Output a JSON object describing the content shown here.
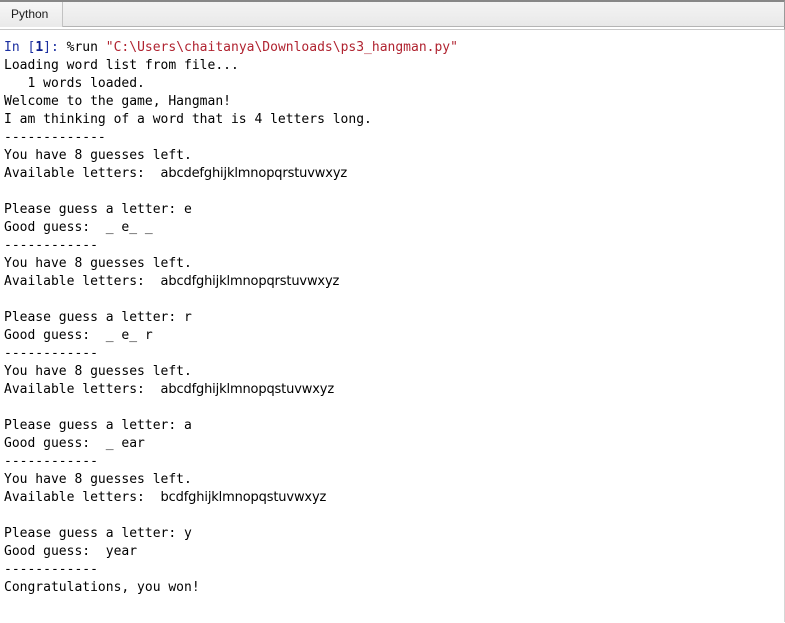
{
  "window": {
    "tab_label": "Python"
  },
  "console": {
    "prompt": {
      "prefix": "In [",
      "number": "1",
      "suffix": "]: ",
      "command": "%run ",
      "path": "\"C:\\Users\\chaitanya\\Downloads\\ps3_hangman.py\""
    },
    "lines": [
      {
        "id": "loading",
        "text": "Loading word list from file..."
      },
      {
        "id": "words-loaded",
        "text": "   1 words loaded."
      },
      {
        "id": "welcome",
        "text": "Welcome to the game, Hangman!"
      },
      {
        "id": "word-length",
        "text": "I am thinking of a word that is 4 letters long."
      },
      {
        "id": "sep-1",
        "text": "-------------"
      },
      {
        "id": "guesses-1",
        "text": "You have 8 guesses left."
      },
      {
        "id": "available-1",
        "label": "Available letters:  ",
        "letters": "abcdefghijklmnopqrstuvwxyz"
      },
      {
        "id": "blank-1",
        "text": ""
      },
      {
        "id": "guess-prompt-1",
        "text": "Please guess a letter: e"
      },
      {
        "id": "good-guess-1",
        "text": "Good guess:  _ e_ _"
      },
      {
        "id": "sep-2",
        "text": "------------"
      },
      {
        "id": "guesses-2",
        "text": "You have 8 guesses left."
      },
      {
        "id": "available-2",
        "label": "Available letters:  ",
        "letters": "abcdfghijklmnopqrstuvwxyz"
      },
      {
        "id": "blank-2",
        "text": ""
      },
      {
        "id": "guess-prompt-2",
        "text": "Please guess a letter: r"
      },
      {
        "id": "good-guess-2",
        "text": "Good guess:  _ e_ r"
      },
      {
        "id": "sep-3",
        "text": "------------"
      },
      {
        "id": "guesses-3",
        "text": "You have 8 guesses left."
      },
      {
        "id": "available-3",
        "label": "Available letters:  ",
        "letters": "abcdfghijklmnopqstuvwxyz"
      },
      {
        "id": "blank-3",
        "text": ""
      },
      {
        "id": "guess-prompt-3",
        "text": "Please guess a letter: a"
      },
      {
        "id": "good-guess-3",
        "text": "Good guess:  _ ear"
      },
      {
        "id": "sep-4",
        "text": "------------"
      },
      {
        "id": "guesses-4",
        "text": "You have 8 guesses left."
      },
      {
        "id": "available-4",
        "label": "Available letters:  ",
        "letters": "bcdfghijklmnopqstuvwxyz"
      },
      {
        "id": "blank-4",
        "text": ""
      },
      {
        "id": "guess-prompt-4",
        "text": "Please guess a letter: y"
      },
      {
        "id": "good-guess-4",
        "text": "Good guess:  year"
      },
      {
        "id": "sep-5",
        "text": "------------"
      },
      {
        "id": "congrats",
        "text": "Congratulations, you won!"
      }
    ]
  },
  "colors": {
    "prompt_blue": "#1a2ea0",
    "string_red": "#b02330",
    "output_black": "#000000",
    "console_bg": "#ffffff",
    "tab_bg": "#eeeeee"
  }
}
